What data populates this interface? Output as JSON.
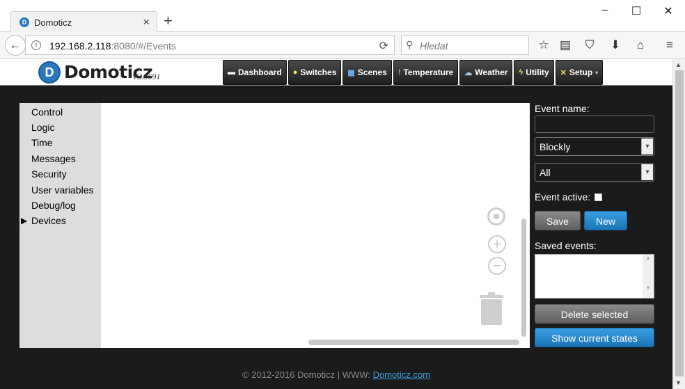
{
  "browser": {
    "tab_title": "Domoticz",
    "new_tab_symbol": "+",
    "url_host": "192.168.2.118",
    "url_rest": ":8080/#/Events",
    "search_placeholder": "Hledat"
  },
  "app": {
    "logo": "Domoticz",
    "version": "V3.5691",
    "menu": [
      {
        "label": "Dashboard",
        "icon": "dashboard-icon"
      },
      {
        "label": "Switches",
        "icon": "bulb-icon"
      },
      {
        "label": "Scenes",
        "icon": "scenes-icon"
      },
      {
        "label": "Temperature",
        "icon": "thermometer-icon"
      },
      {
        "label": "Weather",
        "icon": "cloud-rain-icon"
      },
      {
        "label": "Utility",
        "icon": "utility-icon"
      },
      {
        "label": "Setup",
        "icon": "tools-icon",
        "has_dropdown": true
      }
    ]
  },
  "toolbox": {
    "items": [
      "Control",
      "Logic",
      "Time",
      "Messages",
      "Security",
      "User variables",
      "Debug/log",
      "Devices"
    ],
    "selected": "Devices"
  },
  "event_panel": {
    "name_label": "Event name:",
    "name_value": "",
    "type_select": "Blockly",
    "trigger_select": "All",
    "active_label": "Event active:",
    "active_checked": false,
    "save_label": "Save",
    "new_label": "New",
    "saved_label": "Saved events:",
    "saved_items": [],
    "delete_label": "Delete selected",
    "states_label": "Show current states"
  },
  "footer": {
    "copyright": "© 2012-2016 Domoticz | WWW: ",
    "link_text": "Domoticz.com"
  },
  "colors": {
    "accent_blue": "#2b78bf",
    "button_blue": "#1b75b8",
    "page_background": "#1b1b1b"
  }
}
